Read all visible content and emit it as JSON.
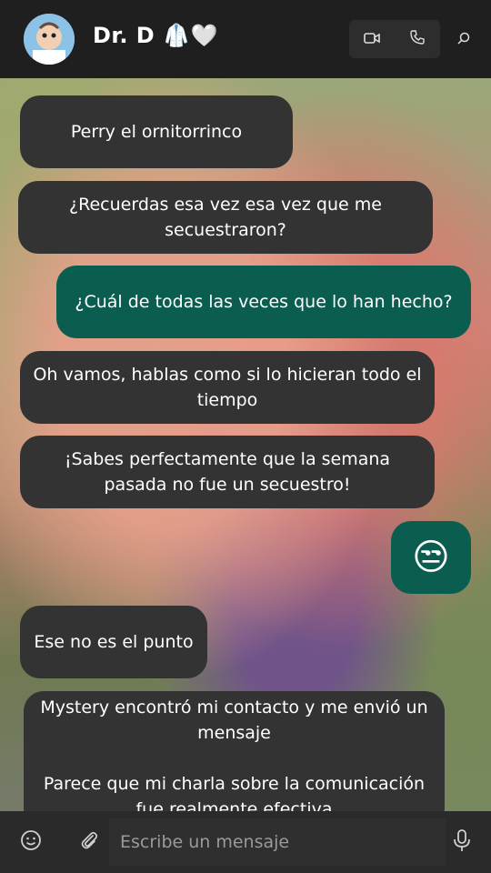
{
  "header": {
    "contact_name": "Dr. D",
    "name_emojis": "🥼🤍",
    "icons": [
      "video-camera-icon",
      "phone-icon",
      "search-icon"
    ]
  },
  "messages": [
    {
      "direction": "in",
      "text": "Perry el ornitorrinco"
    },
    {
      "direction": "in",
      "text": "¿Recuerdas esa vez esa vez que me secuestraron?"
    },
    {
      "direction": "out",
      "text": "¿Cuál de todas las veces que lo han hecho?"
    },
    {
      "direction": "in",
      "text": "Oh vamos, hablas como si lo hicieran todo el tiempo"
    },
    {
      "direction": "in",
      "text": "¡Sabes perfectamente que la semana pasada no fue un secuestro!"
    },
    {
      "direction": "out",
      "text": "😒"
    },
    {
      "direction": "in",
      "text": "Ese no es el punto"
    },
    {
      "direction": "in",
      "text": "Mystery encontró mi contacto y me envió un mensaje\n\nParece que mi charla sobre la comunicación fue realmente efectiva"
    }
  ],
  "composer": {
    "placeholder": "Escribe un mensaje",
    "icons": [
      "emoji-icon",
      "attach-icon",
      "microphone-icon"
    ]
  },
  "colors": {
    "incoming_bubble": "#333333",
    "outgoing_bubble": "#0b5d50",
    "header_bg": "#1f1f1f"
  }
}
